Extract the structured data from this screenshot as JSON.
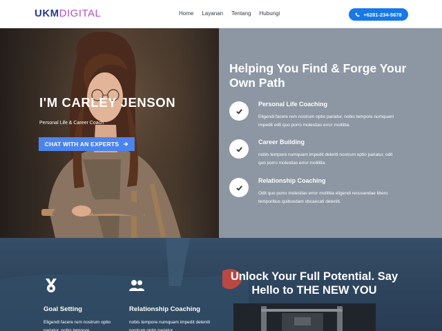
{
  "header": {
    "logo_part1": "UKM",
    "logo_part2": "DIGITAL",
    "nav": [
      "Home",
      "Layanan",
      "Tentang",
      "Hubungi"
    ],
    "phone": "+6281-234-5678",
    "phone_icon": "phone-icon"
  },
  "hero": {
    "name": "I'M CARLEY JENSON",
    "subtitle": "Personal Life & Career Coach",
    "cta": "CHAT WITH AN EXPERTS",
    "cta_icon": "arrow-right-icon"
  },
  "services": {
    "title": "Helping You Find & Forge Your Own Path",
    "items": [
      {
        "title": "Personal Life Coaching",
        "text": "Eligendi facere rem nostrum optio pariatur, nobis tempore numquam impedit odit quo porro molestias error molilitia."
      },
      {
        "title": "Career Building",
        "text": "nobis tempore numquam impedit deleriti nostrum optio pariatur, odit quo porro molestias error molilitia."
      },
      {
        "title": "Relationship Coaching",
        "text": "Odit quo porro molestias error molilitia eligendi recusandae libero temporibus quibusdam obcaecati deleniti."
      }
    ],
    "icon": "check-icon"
  },
  "bottom": {
    "cards": [
      {
        "title": "Goal Setting",
        "text": "Eligendi facere rem nostrum optio pariatur, nobis tempore",
        "icon": "medal-icon"
      },
      {
        "title": "Relationship Coaching",
        "text": "nobis tempore numquam impedit deleniti nostrum optio pariatur",
        "icon": "users-icon"
      }
    ],
    "title": "Unlock Your Full Potential. Say Hello to THE NEW YOU"
  },
  "colors": {
    "accent": "#1778e8",
    "cta": "#4b84ea",
    "panel": "#8c97a3",
    "dark": "#2f465e"
  }
}
